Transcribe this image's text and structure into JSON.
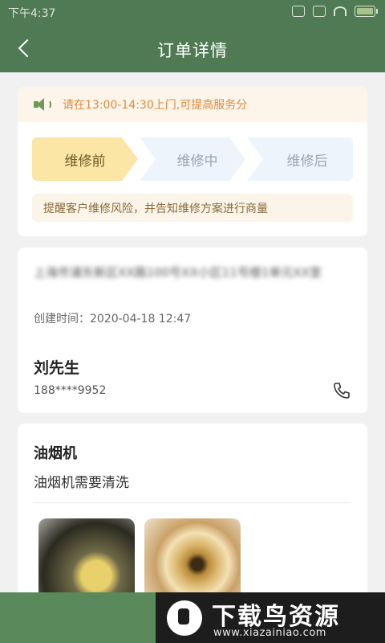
{
  "status_bar": {
    "time": "下午4:37"
  },
  "header": {
    "title": "订单详情"
  },
  "notice": {
    "text": "请在13:00-14:30上门,可提高服务分"
  },
  "steps": [
    {
      "label": "维修前",
      "active": true
    },
    {
      "label": "维修中",
      "active": false
    },
    {
      "label": "维修后",
      "active": false
    }
  ],
  "tip": "提醒客户维修风险，并告知维修方案进行商量",
  "order": {
    "address": "上海市浦东新区XX路100号XX小区11号楼1单元XX室",
    "created_label": "创建时间：",
    "created_time": "2020-04-18 12:47",
    "customer_name": "刘先生",
    "phone": "188****9952"
  },
  "device": {
    "name": "油烟机",
    "description": "油烟机需要清洗"
  },
  "watermark": {
    "title": "下载鸟资源",
    "url": "www.xiazainiao.com"
  },
  "colors": {
    "header_green": "#4f7a53",
    "notice_orange": "#e2893b",
    "active_step": "#fbe6a6"
  }
}
